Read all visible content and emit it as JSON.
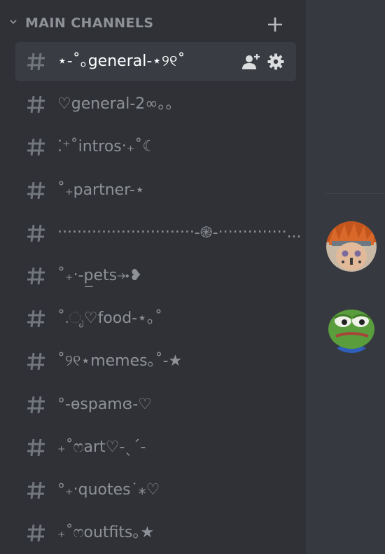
{
  "category": {
    "label": "MAIN CHANNELS",
    "chevron_icon": "chevron-down-icon",
    "add_icon": "plus-icon"
  },
  "channels": [
    {
      "name": "⋆-˚｡general-⋆୨୧˚",
      "selected": true
    },
    {
      "name": "♡general-2∞｡｡",
      "selected": false
    },
    {
      "name": "⁚⁺˚intros‧₊˚☾",
      "selected": false
    },
    {
      "name": "˚₊partner-⋆",
      "selected": false
    },
    {
      "name": "‧‧‧‧‧‧‧‧‧‧‧‧‧‧‧‧‧‧‧‧‧‧‧‧‧‧‧‧-֎-‧‧‧‧‧‧‧‧‧‧‧‧‧‧...",
      "selected": false
    },
    {
      "name": "˚₊‧-p̲ets⤞❥",
      "selected": false
    },
    {
      "name": "˚.ೃ♡food-⋆｡˚",
      "selected": false
    },
    {
      "name": "˚୨୧⋆memes｡˚-★",
      "selected": false
    },
    {
      "name": "°-ɵspamɞ-♡",
      "selected": false
    },
    {
      "name": "₊˚ෆart♡-ˎˊ-",
      "selected": false
    },
    {
      "name": "°₊‧quotes˙⁎♡",
      "selected": false
    },
    {
      "name": "₊˚ෆoutfits｡★",
      "selected": false
    }
  ],
  "selected_channel_icons": [
    "add-member-icon",
    "gear-icon"
  ],
  "colors": {
    "sidebar_bg": "#2f3136",
    "main_bg": "#36393f",
    "selected_bg": "#393c43",
    "muted_text": "#8e9297",
    "active_text": "#ffffff"
  }
}
